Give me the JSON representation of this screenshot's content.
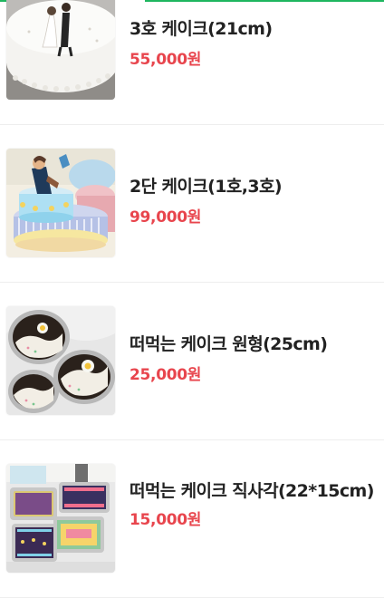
{
  "theme": {
    "accent": "#1eb65f",
    "price_color": "#e8454d",
    "name_color": "#222222",
    "divider": "#eeeeee"
  },
  "products": [
    {
      "name": "3호 케이크(21cm)",
      "price": "55,000원",
      "image": "wedding-couple-cake-photo"
    },
    {
      "name": "2단 케이크(1호,3호)",
      "price": "99,000원",
      "image": "two-tier-cake-photo"
    },
    {
      "name": "떠먹는 케이크 원형(25cm)",
      "price": "25,000원",
      "image": "round-spoon-cake-photo"
    },
    {
      "name": "떠먹는 케이크 직사각(22*15cm)",
      "price": "15,000원",
      "image": "rectangle-spoon-cake-photo"
    }
  ]
}
